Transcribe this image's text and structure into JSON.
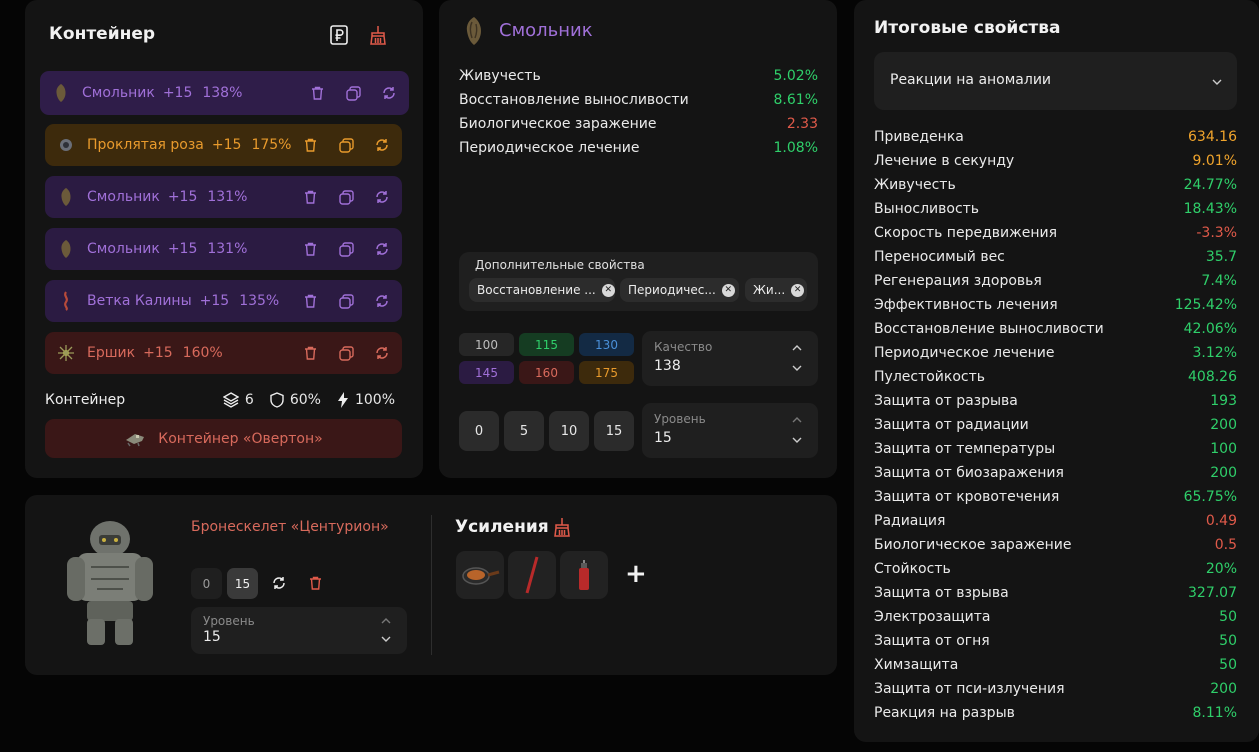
{
  "container": {
    "title": "Контейнер",
    "rows": [
      {
        "name": "Смольник",
        "level": "+15",
        "quality": "138%",
        "style": "purple",
        "selected": true
      },
      {
        "name": "Проклятая роза",
        "level": "+15",
        "quality": "175%",
        "style": "orange"
      },
      {
        "name": "Смольник",
        "level": "+15",
        "quality": "131%",
        "style": "purple"
      },
      {
        "name": "Смольник",
        "level": "+15",
        "quality": "131%",
        "style": "purple"
      },
      {
        "name": "Ветка Калины",
        "level": "+15",
        "quality": "135%",
        "style": "purple"
      },
      {
        "name": "Ершик",
        "level": "+15",
        "quality": "160%",
        "style": "red"
      }
    ],
    "footer_label": "Контейнер",
    "slots": "6",
    "protection": "60%",
    "efficiency": "100%",
    "container_button": "Контейнер «Овертон»"
  },
  "artifact": {
    "title": "Смольник",
    "properties": [
      {
        "name": "Живучесть",
        "value": "5.02%",
        "color": "green"
      },
      {
        "name": "Восстановление выносливости",
        "value": "8.61%",
        "color": "green"
      },
      {
        "name": "Биологическое заражение",
        "value": "2.33",
        "color": "red"
      },
      {
        "name": "Периодическое лечение",
        "value": "1.08%",
        "color": "green"
      }
    ],
    "extra_label": "Дополнительные свойства",
    "chips": [
      "Восстановление ...",
      "Периодичес...",
      "Жи..."
    ],
    "quality_buttons": [
      {
        "label": "100",
        "bg": "#262626",
        "fg": "#bdbdbd"
      },
      {
        "label": "115",
        "bg": "#153c22",
        "fg": "#2fcf6a"
      },
      {
        "label": "130",
        "bg": "#132a44",
        "fg": "#4a8fd8"
      },
      {
        "label": "145",
        "bg": "#2b1b42",
        "fg": "#a070d8"
      },
      {
        "label": "160",
        "bg": "#3a1717",
        "fg": "#d86a5c"
      },
      {
        "label": "175",
        "bg": "#3d2a0c",
        "fg": "#e89a2c"
      }
    ],
    "quality_label": "Качество",
    "quality_value": "138",
    "level_buttons": [
      "0",
      "5",
      "10",
      "15"
    ],
    "level_label": "Уровень",
    "level_value": "15"
  },
  "armor": {
    "name": "Бронескелет «Центурион»",
    "level_buttons": [
      "0",
      "15"
    ],
    "level_label": "Уровень",
    "level_value": "15",
    "upgrades_title": "Усиления",
    "add": "+"
  },
  "totals": {
    "title": "Итоговые свойства",
    "select_value": "Реакции на аномалии",
    "rows": [
      {
        "name": "Приведенка",
        "value": "634.16",
        "color": "orange"
      },
      {
        "name": "Лечение в секунду",
        "value": "9.01%",
        "color": "orange"
      },
      {
        "name": "Живучесть",
        "value": "24.77%",
        "color": "green"
      },
      {
        "name": "Выносливость",
        "value": "18.43%",
        "color": "green"
      },
      {
        "name": "Скорость передвижения",
        "value": "-3.3%",
        "color": "red"
      },
      {
        "name": "Переносимый вес",
        "value": "35.7",
        "color": "green"
      },
      {
        "name": "Регенерация здоровья",
        "value": "7.4%",
        "color": "green"
      },
      {
        "name": "Эффективность лечения",
        "value": "125.42%",
        "color": "green"
      },
      {
        "name": "Восстановление выносливости",
        "value": "42.06%",
        "color": "green"
      },
      {
        "name": "Периодическое лечение",
        "value": "3.12%",
        "color": "green"
      },
      {
        "name": "Пулестойкость",
        "value": "408.26",
        "color": "green"
      },
      {
        "name": "Защита от разрыва",
        "value": "193",
        "color": "green"
      },
      {
        "name": "Защита от радиации",
        "value": "200",
        "color": "green"
      },
      {
        "name": "Защита от температуры",
        "value": "100",
        "color": "green"
      },
      {
        "name": "Защита от биозаражения",
        "value": "200",
        "color": "green"
      },
      {
        "name": "Защита от кровотечения",
        "value": "65.75%",
        "color": "green"
      },
      {
        "name": "Радиация",
        "value": "0.49",
        "color": "red"
      },
      {
        "name": "Биологическое заражение",
        "value": "0.5",
        "color": "red"
      },
      {
        "name": "Стойкость",
        "value": "20%",
        "color": "green"
      },
      {
        "name": "Защита от взрыва",
        "value": "327.07",
        "color": "green"
      },
      {
        "name": "Электрозащита",
        "value": "50",
        "color": "green"
      },
      {
        "name": "Защита от огня",
        "value": "50",
        "color": "green"
      },
      {
        "name": "Химзащита",
        "value": "50",
        "color": "green"
      },
      {
        "name": "Защита от пси-излучения",
        "value": "200",
        "color": "green"
      },
      {
        "name": "Реакция на разрыв",
        "value": "8.11%",
        "color": "green"
      }
    ]
  }
}
